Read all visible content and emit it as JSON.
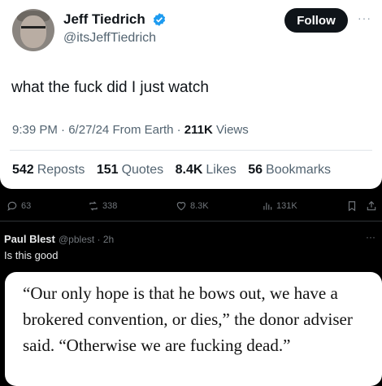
{
  "tweet": {
    "author_name": "Jeff Tiedrich",
    "author_handle": "@itsJeffTiedrich",
    "follow_label": "Follow",
    "more_label": "···",
    "text": "what the fuck did I just watch",
    "time": "9:39 PM",
    "date": "6/27/24",
    "source": "From Earth",
    "views_count": "211K",
    "views_label": "Views",
    "reposts_count": "542",
    "reposts_label": "Reposts",
    "quotes_count": "151",
    "quotes_label": "Quotes",
    "likes_count": "8.4K",
    "likes_label": "Likes",
    "bookmarks_count": "56",
    "bookmarks_label": "Bookmarks"
  },
  "actions": {
    "replies": "63",
    "reposts": "338",
    "likes": "8.3K",
    "views": "131K"
  },
  "reply": {
    "name": "Paul Blest",
    "handle": "@pblest",
    "time": "· 2h",
    "more_label": "···",
    "text": "Is this good",
    "quote": "“Our only hope is that he bows out, we have a brokered convention, or dies,” the donor adviser said. “Otherwise we are fucking dead.”"
  },
  "colors": {
    "accent": "#1d9bf0",
    "dark_bg": "#000000",
    "muted": "#536471"
  }
}
